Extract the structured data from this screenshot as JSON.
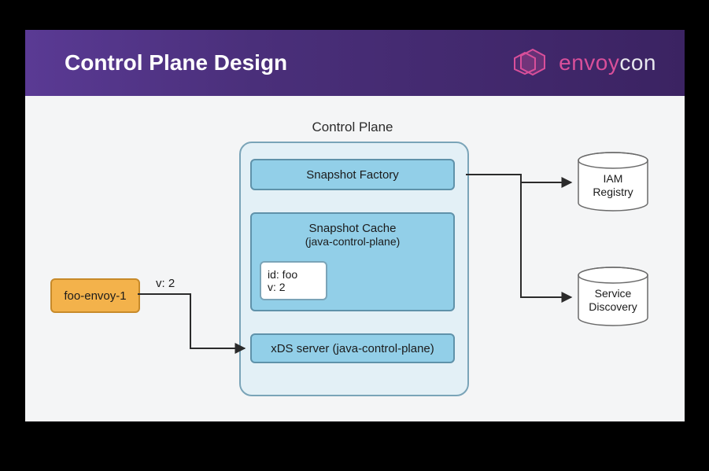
{
  "header": {
    "title": "Control Plane Design",
    "brand_envoy": "envoy",
    "brand_con": "con"
  },
  "diagram": {
    "panel_label": "Control Plane",
    "snapshot_factory": "Snapshot Factory",
    "snapshot_cache_title": "Snapshot Cache",
    "snapshot_cache_sub": "(java-control-plane)",
    "inner_id_line1": "id: foo",
    "inner_id_line2": "v: 2",
    "xds": "xDS server (java-control-plane)",
    "envoy": "foo-envoy-1",
    "version_label": "v: 2",
    "iam_line1": "IAM",
    "iam_line2": "Registry",
    "svc_line1": "Service",
    "svc_line2": "Discovery"
  },
  "colors": {
    "header_purple": "#4a2f7a",
    "brand_pink": "#d94f9a",
    "panel_bg": "#e3f0f6",
    "box_fill": "#92cfe8",
    "box_border": "#5f92aa",
    "envoy_fill": "#f3b24b",
    "arrow": "#2b2b2b"
  }
}
